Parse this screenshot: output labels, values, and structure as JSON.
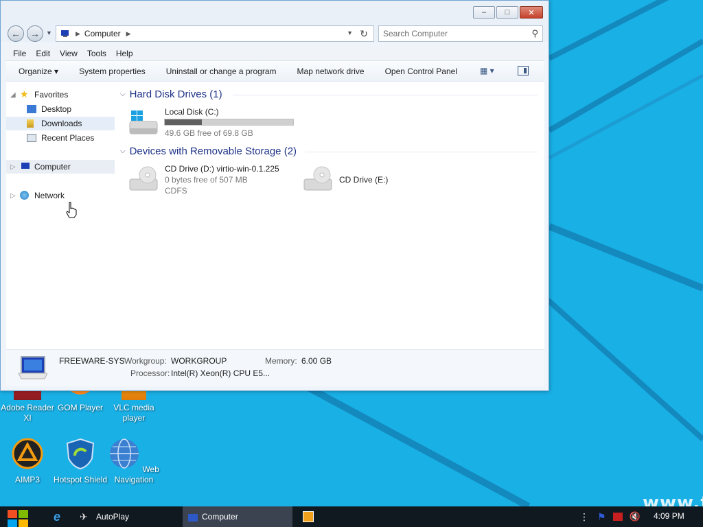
{
  "window": {
    "title_buttons": {
      "minimize": "–",
      "maximize": "□",
      "close": "✕"
    },
    "address": {
      "location": "Computer"
    },
    "search": {
      "placeholder": "Search Computer"
    },
    "menu": [
      "File",
      "Edit",
      "View",
      "Tools",
      "Help"
    ],
    "toolbar": {
      "organize": "Organize ▾",
      "system_properties": "System properties",
      "uninstall": "Uninstall or change a program",
      "map_drive": "Map network drive",
      "control_panel": "Open Control Panel"
    },
    "navpane": {
      "favorites": "Favorites",
      "desktop": "Desktop",
      "downloads": "Downloads",
      "recent": "Recent Places",
      "computer": "Computer",
      "network": "Network"
    },
    "groups": {
      "hdd_header": "Hard Disk Drives (1)",
      "removable_header": "Devices with Removable Storage (2)"
    },
    "drives": {
      "c": {
        "name": "Local Disk (C:)",
        "free": "49.6 GB free of 69.8 GB",
        "used_fraction": 0.29
      },
      "d": {
        "name": "CD Drive (D:) virtio-win-0.1.225",
        "free": "0 bytes free of 507 MB",
        "fs": "CDFS"
      },
      "e": {
        "name": "CD Drive (E:)"
      }
    },
    "details": {
      "computer_name": "FREEWARE-SYS",
      "workgroup_label": "Workgroup:",
      "workgroup_value": "WORKGROUP",
      "memory_label": "Memory:",
      "memory_value": "6.00 GB",
      "processor_label": "Processor:",
      "processor_value": "Intel(R) Xeon(R) CPU E5..."
    }
  },
  "desktop_icons": {
    "adobe": "Adobe Reader XI",
    "gom": "GOM Player",
    "vlc": "VLC media player",
    "aimp": "AIMP3",
    "hotspot": "Hotspot Shield",
    "web": "Web Navigation"
  },
  "watermark": "www.fr",
  "taskbar": {
    "autoplay": "AutoPlay",
    "computer": "Computer",
    "clock": "4:09 PM"
  },
  "colors": {
    "desktop": "#19b0e6",
    "taskbar": "#101820",
    "accent": "#1e3287"
  }
}
